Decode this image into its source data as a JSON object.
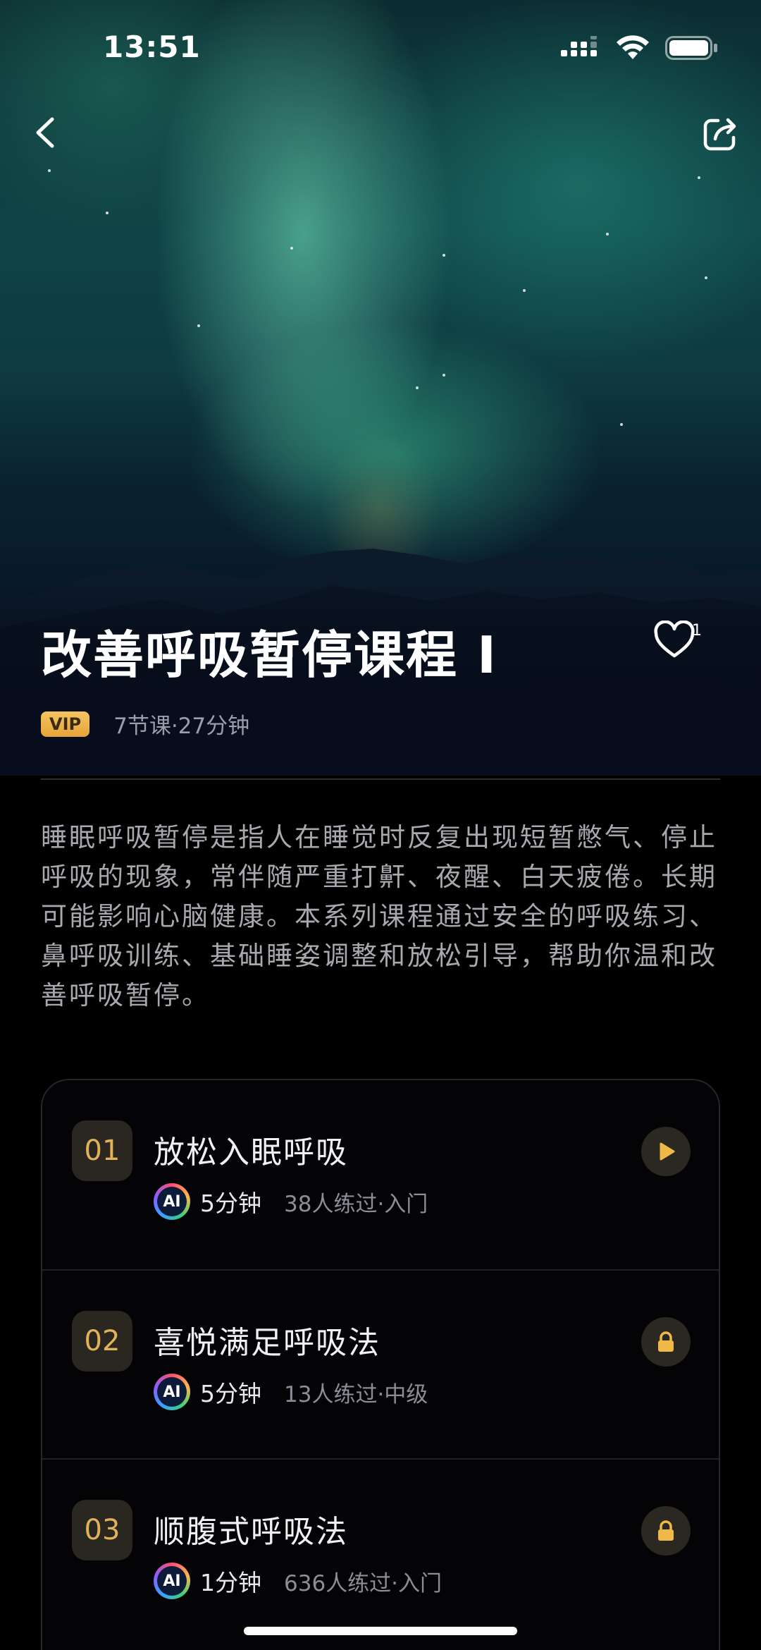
{
  "status_bar": {
    "time": "13:51"
  },
  "header": {
    "back_icon": "chevron-left-icon",
    "share_icon": "share-icon"
  },
  "course": {
    "title": "改善呼吸暂停课程 I",
    "favorite_count": "1",
    "badge": "VIP",
    "meta": "7节课·27分钟",
    "description": "睡眠呼吸暂停是指人在睡觉时反复出现短暂憋气、停止呼吸的现象，常伴随严重打鼾、夜醒、白天疲倦。长期可能影响心脑健康。本系列课程通过安全的呼吸练习、鼻呼吸训练、基础睡姿调整和放松引导，帮助你温和改善呼吸暂停。"
  },
  "lessons": [
    {
      "number": "01",
      "title": "放松入眠呼吸",
      "ai_label": "AI",
      "duration": "5分钟",
      "stats": "38人练过·入门",
      "action": "play"
    },
    {
      "number": "02",
      "title": "喜悦满足呼吸法",
      "ai_label": "AI",
      "duration": "5分钟",
      "stats": "13人练过·中级",
      "action": "locked"
    },
    {
      "number": "03",
      "title": "顺腹式呼吸法",
      "ai_label": "AI",
      "duration": "1分钟",
      "stats": "636人练过·入门",
      "action": "locked"
    }
  ],
  "colors": {
    "accent": "#e2b25a",
    "background": "#000000",
    "vip_badge": "#f0b94e"
  }
}
